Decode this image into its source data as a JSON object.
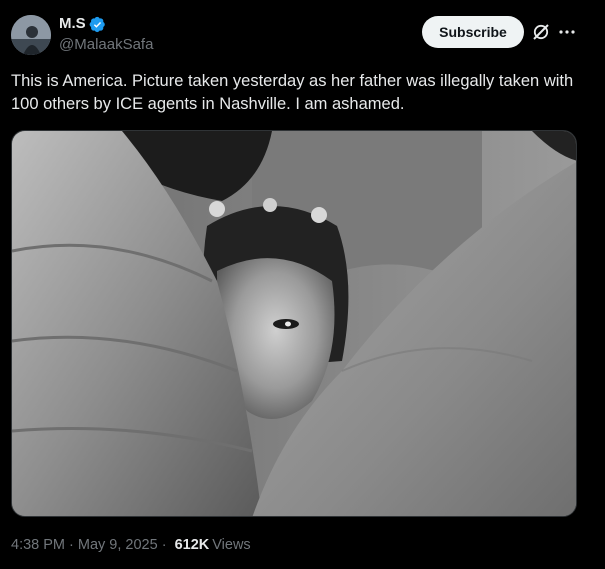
{
  "author": {
    "display_name": "M.S",
    "handle": "@MalaakSafa",
    "verified": true,
    "verified_color": "#1d9bf0"
  },
  "actions": {
    "subscribe_label": "Subscribe",
    "grok_icon": "grok-icon",
    "more_icon": "more-icon"
  },
  "tweet": {
    "text": "This is America. Picture taken yesterday as her father was illegally taken with 100 others by ICE agents in Nashville. I am ashamed."
  },
  "media": {
    "type": "photo",
    "style": "black-and-white"
  },
  "meta": {
    "timestamp": "4:38 PM · May 9, 2025",
    "separator": "·",
    "views_count": "612K",
    "views_label": "Views"
  },
  "colors": {
    "background": "#000000",
    "text_primary": "#e7e9ea",
    "text_secondary": "#71767b",
    "button_bg": "#eff3f4",
    "button_text": "#0f1419"
  }
}
